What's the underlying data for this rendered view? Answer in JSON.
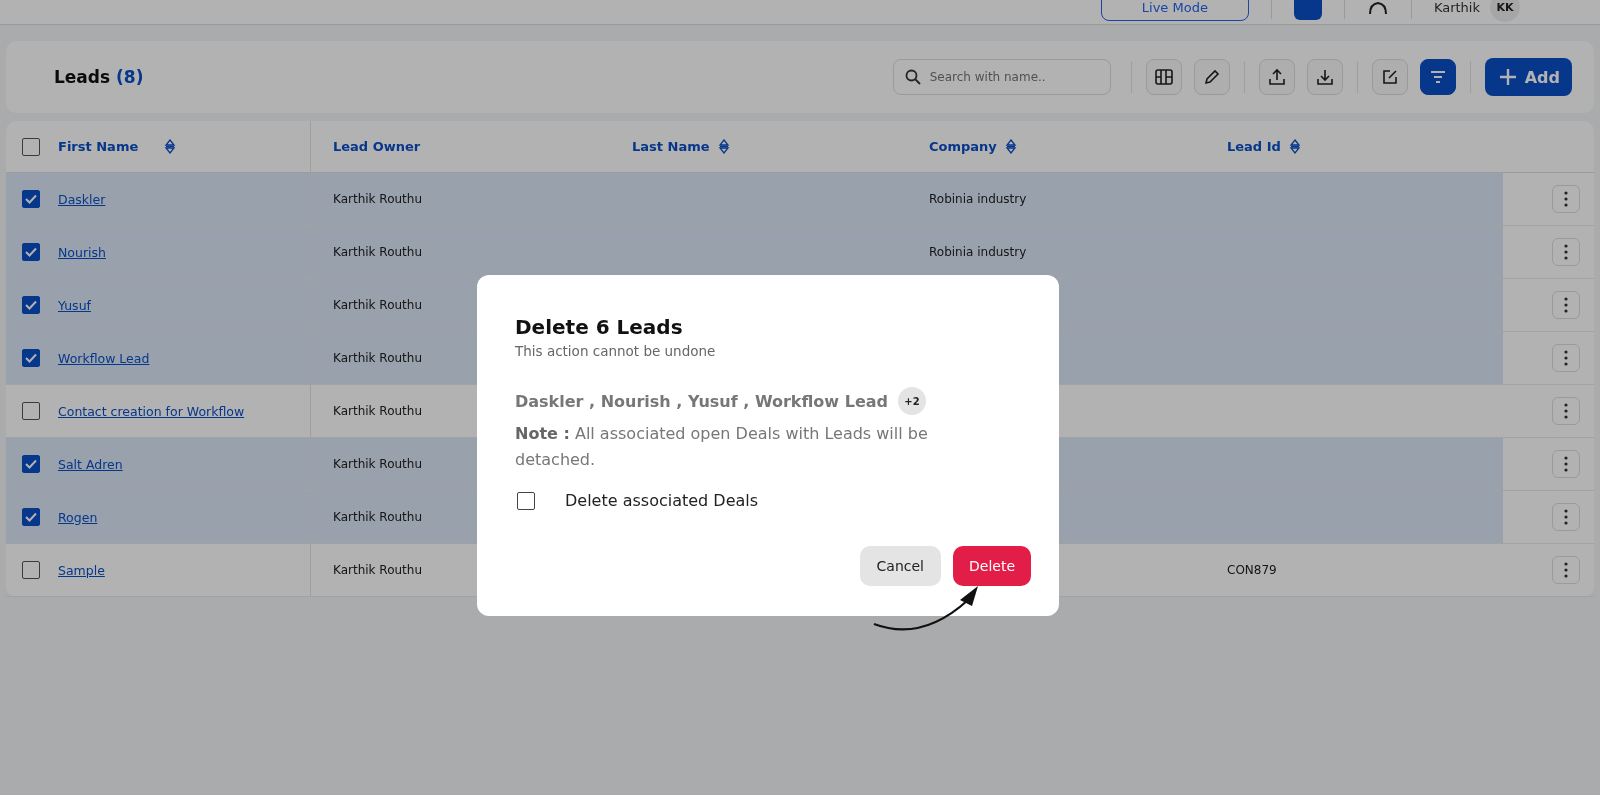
{
  "top_bar": {
    "mode_button": "Live Mode",
    "user_name": "Karthik",
    "user_initials": "KK"
  },
  "toolbar": {
    "title": "Leads",
    "count": "(8)",
    "search": {
      "placeholder": "Search with name.."
    },
    "filter_active": true,
    "add_button": "Add"
  },
  "table": {
    "select_all_checked": false,
    "columns": [
      {
        "label": "First Name",
        "sortable": true
      },
      {
        "label": "Lead Owner",
        "sortable": false
      },
      {
        "label": "Last Name",
        "sortable": true
      },
      {
        "label": "Company",
        "sortable": true
      },
      {
        "label": "Lead Id",
        "sortable": true
      }
    ],
    "rows": [
      {
        "selected": true,
        "first_name": "Daskler",
        "lead_owner": "Karthik Routhu",
        "company": "Robinia industry"
      },
      {
        "selected": true,
        "first_name": "Nourish",
        "lead_owner": "Karthik Routhu",
        "company": "Robinia industry"
      },
      {
        "selected": true,
        "first_name": "Yusuf",
        "lead_owner": "Karthik Routhu"
      },
      {
        "selected": true,
        "first_name": "Workflow Lead",
        "lead_owner": "Karthik Routhu"
      },
      {
        "selected": false,
        "first_name": "Contact creation for Workflow",
        "lead_owner": "Karthik Routhu"
      },
      {
        "selected": true,
        "first_name": "Salt Adren",
        "lead_owner": "Karthik Routhu"
      },
      {
        "selected": true,
        "first_name": "Rogen",
        "lead_owner": "Karthik Routhu"
      },
      {
        "selected": false,
        "first_name": "Sample",
        "lead_owner": "Karthik Routhu",
        "lead_id": "CON879"
      }
    ]
  },
  "dialog": {
    "title": "Delete 6 Leads",
    "subtitle": "This action cannot be undone",
    "names": "Daskler , Nourish , Yusuf , Workflow Lead",
    "more_badge": "+2",
    "note": "**Note :** All associated open Deals with Leads will be detached.",
    "option": {
      "label": "Delete associated Deals",
      "checked": false
    },
    "cancel_button": "Cancel",
    "delete_button": "Delete"
  }
}
